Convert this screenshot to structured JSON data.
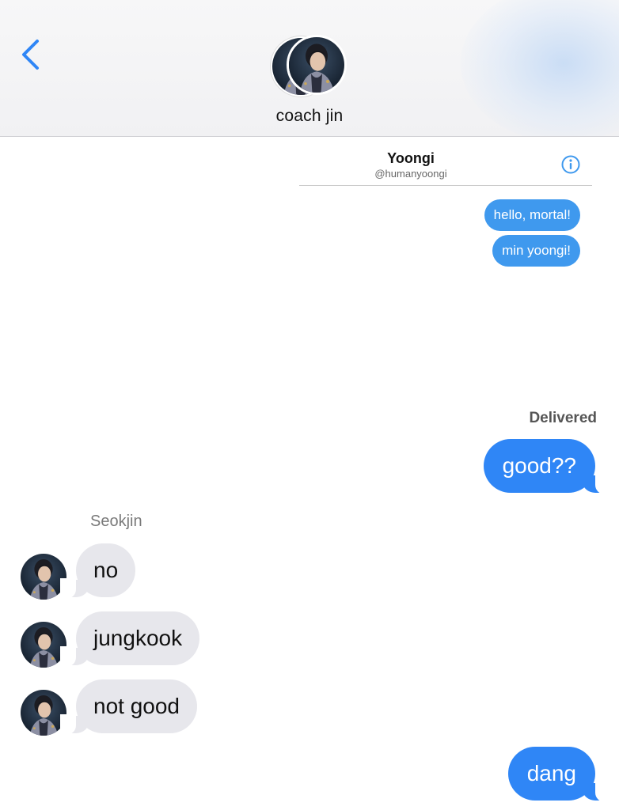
{
  "header": {
    "contact_name": "coach jin",
    "back_icon": "chevron-left-icon",
    "accent_color": "#2f86f6"
  },
  "card": {
    "name": "Yoongi",
    "handle": "@humanyoongi",
    "info_icon": "info-circle-icon",
    "messages": [
      "hello, mortal!",
      "min yoongi!"
    ]
  },
  "thread": {
    "delivered_label": "Delivered",
    "sender_name": "Seokjin",
    "messages": [
      {
        "direction": "sent",
        "text": "good??"
      },
      {
        "direction": "received",
        "text": "no"
      },
      {
        "direction": "received",
        "text": "jungkook"
      },
      {
        "direction": "received",
        "text": "not good"
      },
      {
        "direction": "sent",
        "text": "dang"
      }
    ]
  },
  "colors": {
    "sent_bubble": "#2f86f6",
    "received_bubble": "#e7e7ec",
    "mini_bubble": "#3f99ee"
  }
}
